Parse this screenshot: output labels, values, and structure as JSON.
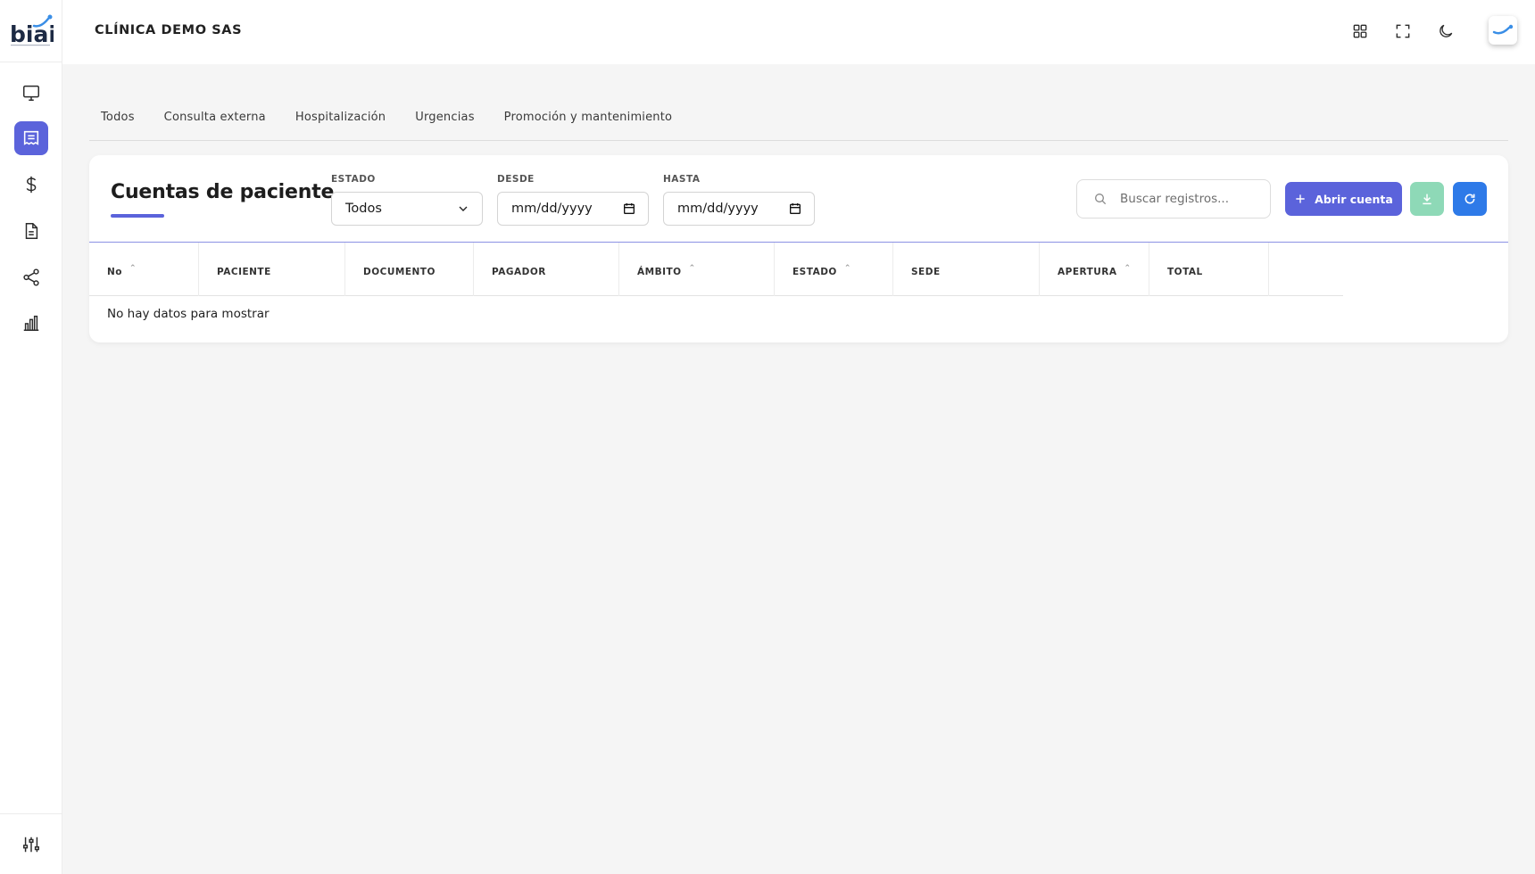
{
  "app": {
    "logo_text": "biai"
  },
  "header": {
    "clinic_name": "CLÍNICA DEMO SAS"
  },
  "tabs": [
    {
      "label": "Todos"
    },
    {
      "label": "Consulta externa"
    },
    {
      "label": "Hospitalización"
    },
    {
      "label": "Urgencias"
    },
    {
      "label": "Promoción y mantenimiento"
    }
  ],
  "card": {
    "title": "Cuentas de paciente",
    "filters": {
      "estado": {
        "label": "ESTADO",
        "value": "Todos"
      },
      "desde": {
        "label": "DESDE",
        "value": "mm/dd/yyyy"
      },
      "hasta": {
        "label": "HASTA",
        "value": "mm/dd/yyyy"
      }
    },
    "search": {
      "placeholder": "Buscar registros..."
    },
    "open_button_label": "Abrir cuenta"
  },
  "table": {
    "columns": [
      "No",
      "PACIENTE",
      "DOCUMENTO",
      "PAGADOR",
      "ÁMBITO",
      "ESTADO",
      "SEDE",
      "APERTURA",
      "TOTAL"
    ],
    "empty_message": "No hay datos para mostrar"
  },
  "colors": {
    "accent": "#5b63db",
    "download": "#8ed9b7",
    "refresh": "#2e7ae8",
    "background": "#f5f5f5"
  },
  "icons": {
    "sidebar": [
      "monitor-icon",
      "receipt-icon",
      "dollar-icon",
      "document-icon",
      "share-icon",
      "bar-chart-icon"
    ],
    "sidebar_bottom": "sliders-icon",
    "topbar": [
      "apps-grid-icon",
      "fullscreen-icon",
      "moon-icon"
    ]
  }
}
